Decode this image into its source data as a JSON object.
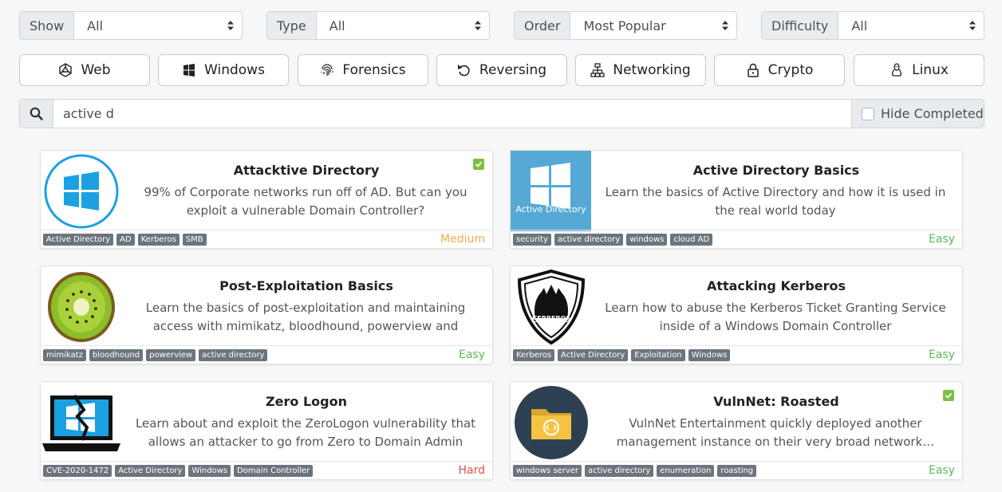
{
  "filters": [
    {
      "label": "Show",
      "value": "All"
    },
    {
      "label": "Type",
      "value": "All"
    },
    {
      "label": "Order",
      "value": "Most Popular"
    },
    {
      "label": "Difficulty",
      "value": "All"
    }
  ],
  "categories": [
    {
      "label": "Web",
      "icon": "web-icon"
    },
    {
      "label": "Windows",
      "icon": "windows-icon"
    },
    {
      "label": "Forensics",
      "icon": "fingerprint-icon"
    },
    {
      "label": "Reversing",
      "icon": "undo-icon"
    },
    {
      "label": "Networking",
      "icon": "network-icon"
    },
    {
      "label": "Crypto",
      "icon": "lock-icon"
    },
    {
      "label": "Linux",
      "icon": "linux-icon"
    }
  ],
  "search": {
    "value": "active d",
    "hide_completed_label": "Hide Completed"
  },
  "colors": {
    "easy": "#5cb85c",
    "medium": "#f0ad4e",
    "hard": "#d9534f",
    "completed": "#7ac142",
    "tag": "#6c757d"
  },
  "rooms": [
    {
      "title": "Attacktive Directory",
      "desc": "99% of Corporate networks run off of AD. But can you exploit a vulnerable Domain Controller?",
      "tags": [
        "Active Directory",
        "AD",
        "Kerberos",
        "SMB"
      ],
      "difficulty": "Medium",
      "completed": true,
      "image": "windows-circle-logo"
    },
    {
      "title": "Active Directory Basics",
      "desc": "Learn the basics of Active Directory and how it is used in the real world today",
      "tags": [
        "security",
        "active directory",
        "windows",
        "cloud AD"
      ],
      "difficulty": "Easy",
      "completed": false,
      "image": "active-directory-logo",
      "image_caption": "Active Directory"
    },
    {
      "title": "Post-Exploitation Basics",
      "desc": "Learn the basics of post-exploitation and maintaining access with mimikatz, bloodhound, powerview and msfvenom",
      "tags": [
        "mimikatz",
        "bloodhound",
        "powerview",
        "active directory"
      ],
      "difficulty": "Easy",
      "completed": false,
      "image": "kiwi-image"
    },
    {
      "title": "Attacking Kerberos",
      "desc": "Learn how to abuse the Kerberos Ticket Granting Service inside of a Windows Domain Controller",
      "tags": [
        "Kerberos",
        "Active Directory",
        "Exploitation",
        "Windows"
      ],
      "difficulty": "Easy",
      "completed": false,
      "image": "kerberos-shield-logo",
      "image_caption": "KERBEROS"
    },
    {
      "title": "Zero Logon",
      "desc": "Learn about and exploit the ZeroLogon vulnerability that allows an attacker to go from Zero to Domain Admin witho…",
      "tags": [
        "CVE-2020-1472",
        "Active Directory",
        "Windows",
        "Domain Controller"
      ],
      "difficulty": "Hard",
      "completed": false,
      "image": "broken-windows-laptop"
    },
    {
      "title": "VulnNet: Roasted",
      "desc": "VulnNet Entertainment quickly deployed another management instance on their very broad network…",
      "tags": [
        "windows server",
        "active directory",
        "enumeration",
        "roasting"
      ],
      "difficulty": "Easy",
      "completed": true,
      "image": "folder-circle-logo"
    }
  ]
}
